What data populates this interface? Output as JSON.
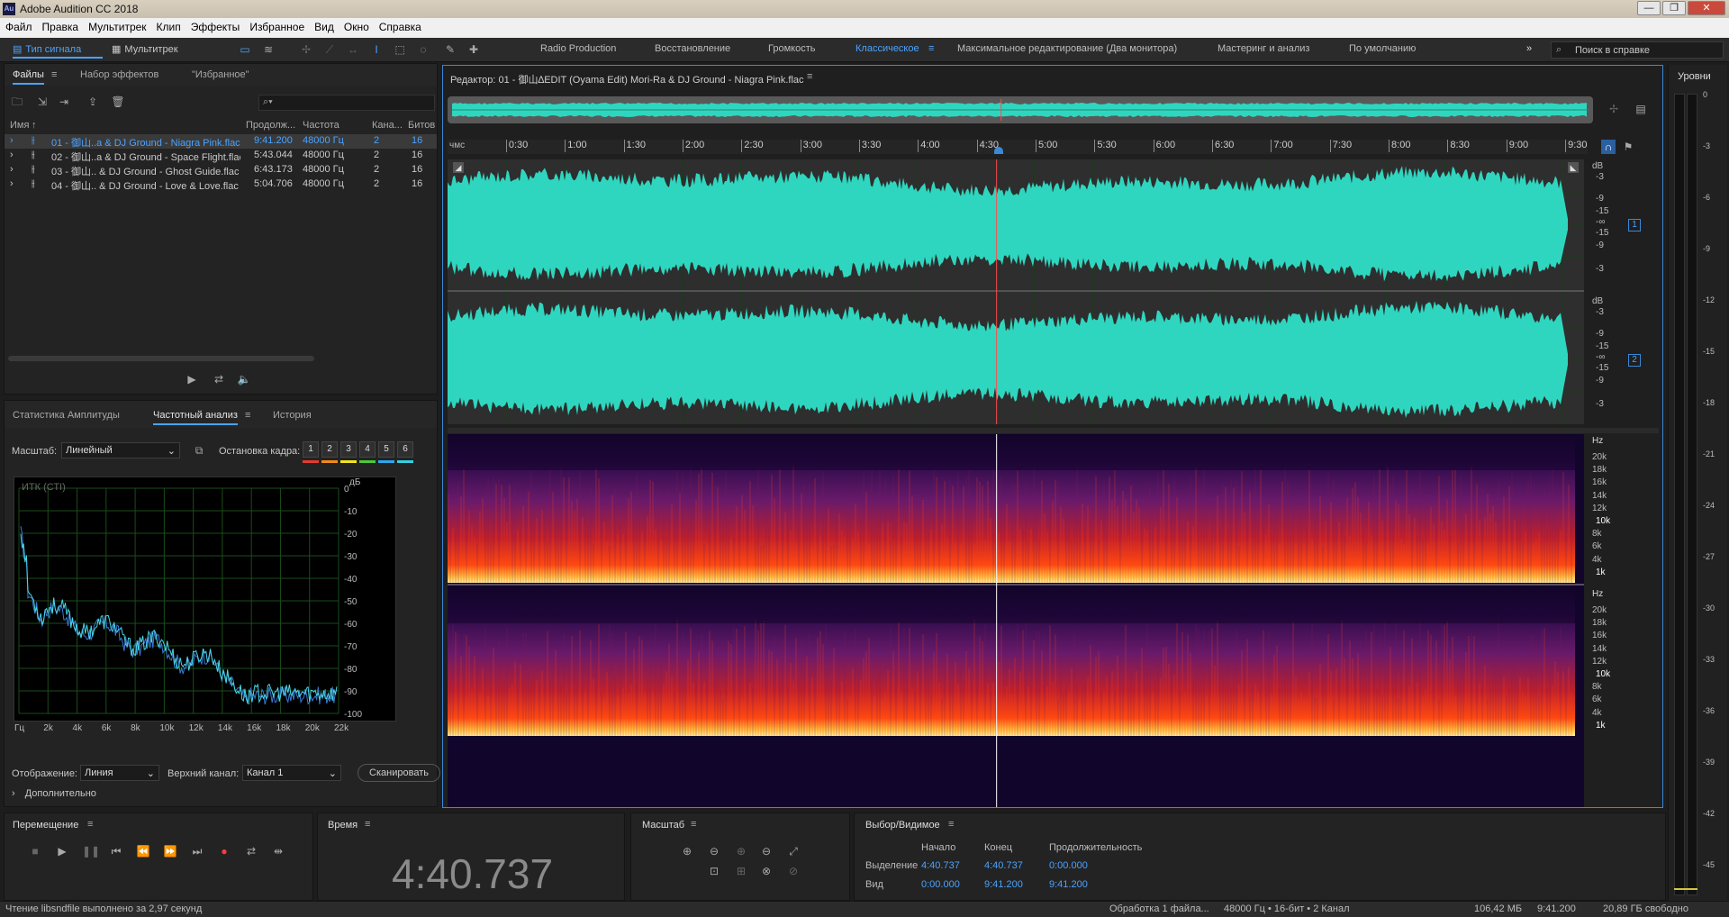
{
  "window": {
    "title": "Adobe Audition CC 2018",
    "logo": "Au",
    "min": "—",
    "max": "❐",
    "close": "✕"
  },
  "menu": [
    "Файл",
    "Правка",
    "Мультитрек",
    "Клип",
    "Эффекты",
    "Избранное",
    "Вид",
    "Окно",
    "Справка"
  ],
  "toolbar": {
    "waveform_label": "Тип сигнала",
    "multitrack_label": "Мультитрек",
    "workspaces": [
      "Radio Production",
      "Восстановление",
      "Громкость",
      "Классическое",
      "Максимальное редактирование (Два монитора)",
      "Мастеринг и анализ",
      "По умолчанию"
    ],
    "active_workspace": "Классическое",
    "search_placeholder": "Поиск в справке"
  },
  "files_panel": {
    "tabs": [
      "Файлы",
      "Набор эффектов",
      "\"Избранное\""
    ],
    "search_placeholder": "",
    "columns": [
      "Имя",
      "Продолж...",
      "Частота",
      "Кана...",
      "Битов"
    ],
    "files": [
      {
        "name": "01 - 御山..a & DJ Ground - Niagra Pink.flac",
        "duration": "9:41.200",
        "rate": "48000 Гц",
        "channels": "2",
        "bits": "16"
      },
      {
        "name": "02 - 御山..a & DJ Ground - Space Flight.flac",
        "duration": "5:43.044",
        "rate": "48000 Гц",
        "channels": "2",
        "bits": "16"
      },
      {
        "name": "03 - 御山.. & DJ Ground - Ghost Guide.flac",
        "duration": "6:43.173",
        "rate": "48000 Гц",
        "channels": "2",
        "bits": "16"
      },
      {
        "name": "04 - 御山.. & DJ Ground - Love & Love.flac",
        "duration": "5:04.706",
        "rate": "48000 Гц",
        "channels": "2",
        "bits": "16"
      }
    ]
  },
  "analysis_panel": {
    "tabs": [
      "Статистика Амплитуды",
      "Частотный анализ",
      "История"
    ],
    "scale_label": "Масштаб:",
    "scale_value": "Линейный",
    "hold_label": "Остановка кадра:",
    "hold_buttons": [
      "1",
      "2",
      "3",
      "4",
      "5",
      "6"
    ],
    "hold_colors": [
      "#e53b2f",
      "#f08a1c",
      "#f2e41d",
      "#4cc93a",
      "#2ea7ee",
      "#35d0e0"
    ],
    "graph_title": "ИТК (СТI)",
    "db_unit": "дБ",
    "db_ticks": [
      "0",
      "-10",
      "-20",
      "-30",
      "-40",
      "-50",
      "-60",
      "-70",
      "-80",
      "-90",
      "-100"
    ],
    "freq_ticks": [
      "Гц",
      "2k",
      "4k",
      "6k",
      "8k",
      "10k",
      "12k",
      "14k",
      "16k",
      "18k",
      "20k",
      "22k"
    ],
    "display_label": "Отображение:",
    "display_value": "Линия",
    "channel_label": "Верхний канал:",
    "channel_value": "Канал 1",
    "scan_label": "Сканировать",
    "advanced_label": "Дополнительно"
  },
  "editor": {
    "title": "Редактор: 01 - 御山∆EDIT (Oyama Edit) Mori-Ra & DJ Ground - Niagra Pink.flac",
    "ruler_unit": "чмс",
    "ruler_ticks": [
      "0:30",
      "1:00",
      "1:30",
      "2:00",
      "2:30",
      "3:00",
      "3:30",
      "4:00",
      "4:30",
      "5:00",
      "5:30",
      "6:00",
      "6:30",
      "7:00",
      "7:30",
      "8:00",
      "8:30",
      "9:00",
      "9:30"
    ],
    "db_unit": "dB",
    "db_scale": [
      "-3",
      "-9",
      "-15",
      "-∞",
      "-15",
      "-9",
      "-3"
    ],
    "channel_badges": [
      "1",
      "2"
    ],
    "hz_unit": "Hz",
    "hz_scale": [
      "20k",
      "18k",
      "16k",
      "14k",
      "12k",
      "10k",
      "8k",
      "6k",
      "4k",
      "1k"
    ],
    "playhead_fraction": 0.4831,
    "waveform_color": "#2fd6bf",
    "playhead_color": "#ff4a4a"
  },
  "levels": {
    "title": "Уровни",
    "ticks": [
      "0",
      "-3",
      "-6",
      "-9",
      "-12",
      "-15",
      "-18",
      "-21",
      "-24",
      "-27",
      "-30",
      "-33",
      "-36",
      "-39",
      "-42",
      "-45"
    ]
  },
  "transport": {
    "title": "Перемещение"
  },
  "time": {
    "title": "Время",
    "value": "4:40.737"
  },
  "zoom": {
    "title": "Масштаб"
  },
  "selection": {
    "title": "Выбор/Видимое",
    "headers": [
      "Начало",
      "Конец",
      "Продолжительность"
    ],
    "rows": [
      {
        "label": "Выделение",
        "start": "4:40.737",
        "end": "4:40.737",
        "duration": "0:00.000"
      },
      {
        "label": "Вид",
        "start": "0:00.000",
        "end": "9:41.200",
        "duration": "9:41.200"
      }
    ]
  },
  "statusbar": {
    "left": "Чтение libsndfile выполнено за 2,97 секунд",
    "processing": "Обработка 1 файла...",
    "format": "48000 Гц • 16-бит • 2 Канал",
    "size": "106,42 МБ",
    "duration": "9:41.200",
    "free": "20,89 ГБ свободно"
  }
}
